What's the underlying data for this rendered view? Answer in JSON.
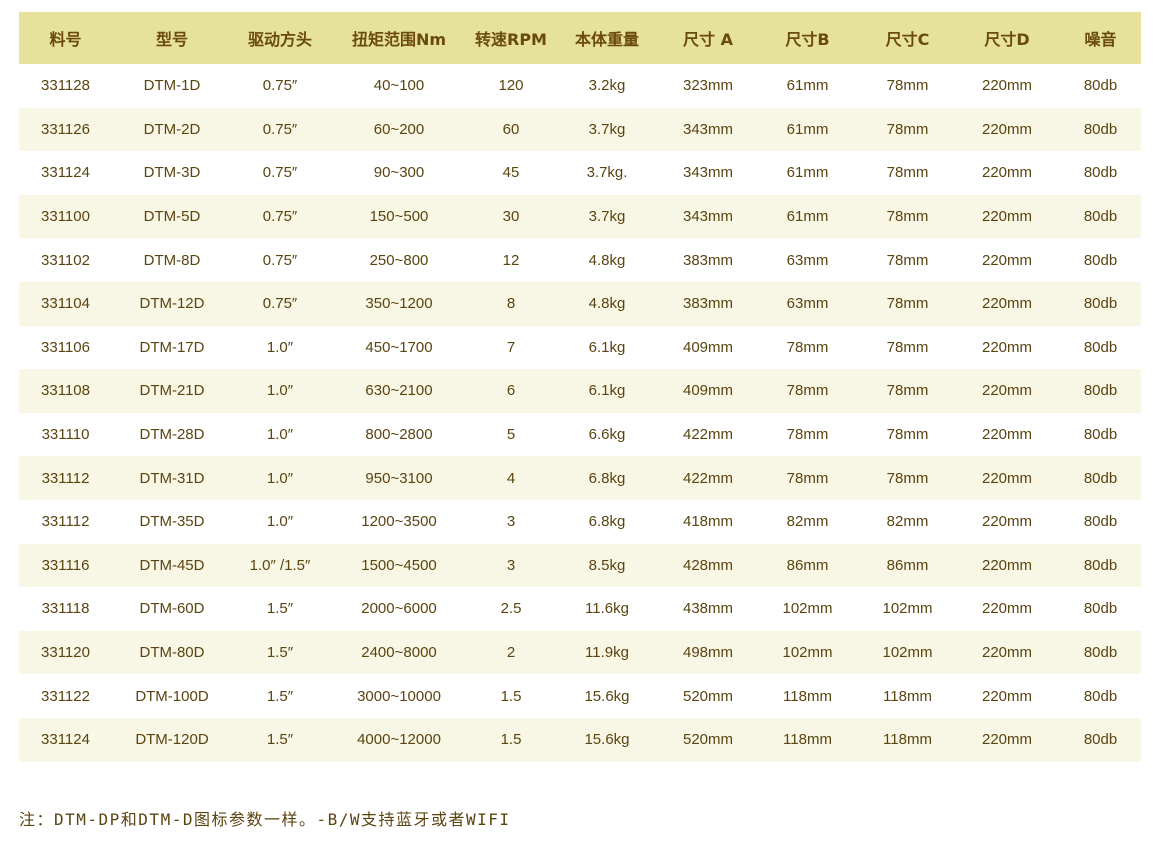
{
  "table": {
    "headers": [
      "料号",
      "型号",
      "驱动方头",
      "扭矩范围Nm",
      "转速RPM",
      "本体重量",
      "尺寸 A",
      "尺寸B",
      "尺寸C",
      "尺寸D",
      "噪音"
    ],
    "rows": [
      [
        "331128",
        "DTM-1D",
        "0.75″",
        "40~100",
        "120",
        "3.2kg",
        "323mm",
        "61mm",
        "78mm",
        "220mm",
        "80db"
      ],
      [
        "331126",
        "DTM-2D",
        "0.75″",
        "60~200",
        "60",
        "3.7kg",
        "343mm",
        "61mm",
        "78mm",
        "220mm",
        "80db"
      ],
      [
        "331124",
        "DTM-3D",
        "0.75″",
        "90~300",
        "45",
        "3.7kg.",
        "343mm",
        "61mm",
        "78mm",
        "220mm",
        "80db"
      ],
      [
        "331100",
        "DTM-5D",
        "0.75″",
        "150~500",
        "30",
        "3.7kg",
        "343mm",
        "61mm",
        "78mm",
        "220mm",
        "80db"
      ],
      [
        "331102",
        "DTM-8D",
        "0.75″",
        "250~800",
        "12",
        "4.8kg",
        "383mm",
        "63mm",
        "78mm",
        "220mm",
        "80db"
      ],
      [
        "331104",
        "DTM-12D",
        "0.75″",
        "350~1200",
        "8",
        "4.8kg",
        "383mm",
        "63mm",
        "78mm",
        "220mm",
        "80db"
      ],
      [
        "331106",
        "DTM-17D",
        "1.0″",
        "450~1700",
        "7",
        "6.1kg",
        "409mm",
        "78mm",
        "78mm",
        "220mm",
        "80db"
      ],
      [
        "331108",
        "DTM-21D",
        "1.0″",
        "630~2100",
        "6",
        "6.1kg",
        "409mm",
        "78mm",
        "78mm",
        "220mm",
        "80db"
      ],
      [
        "331110",
        "DTM-28D",
        "1.0″",
        "800~2800",
        "5",
        "6.6kg",
        "422mm",
        "78mm",
        "78mm",
        "220mm",
        "80db"
      ],
      [
        "331112",
        "DTM-31D",
        "1.0″",
        "950~3100",
        "4",
        "6.8kg",
        "422mm",
        "78mm",
        "78mm",
        "220mm",
        "80db"
      ],
      [
        "331112",
        "DTM-35D",
        "1.0″",
        "1200~3500",
        "3",
        "6.8kg",
        "418mm",
        "82mm",
        "82mm",
        "220mm",
        "80db"
      ],
      [
        "331116",
        "DTM-45D",
        "1.0″ /1.5″",
        "1500~4500",
        "3",
        "8.5kg",
        "428mm",
        "86mm",
        "86mm",
        "220mm",
        "80db"
      ],
      [
        "331118",
        "DTM-60D",
        "1.5″",
        "2000~6000",
        "2.5",
        "11.6kg",
        "438mm",
        "102mm",
        "102mm",
        "220mm",
        "80db"
      ],
      [
        "331120",
        "DTM-80D",
        "1.5″",
        "2400~8000",
        "2",
        "11.9kg",
        "498mm",
        "102mm",
        "102mm",
        "220mm",
        "80db"
      ],
      [
        "331122",
        "DTM-100D",
        "1.5″",
        "3000~10000",
        "1.5",
        "15.6kg",
        "520mm",
        "118mm",
        "118mm",
        "220mm",
        "80db"
      ],
      [
        "331124",
        "DTM-120D",
        "1.5″",
        "4000~12000",
        "1.5",
        "15.6kg",
        "520mm",
        "118mm",
        "118mm",
        "220mm",
        "80db"
      ]
    ]
  },
  "note": "注：DTM-DP和DTM-D图标参数一样。-B/W支持蓝牙或者WIFI",
  "colors": {
    "header_bg": "#e6e19b",
    "stripe_bg": "#f8f6e4",
    "text": "#5a4410"
  }
}
